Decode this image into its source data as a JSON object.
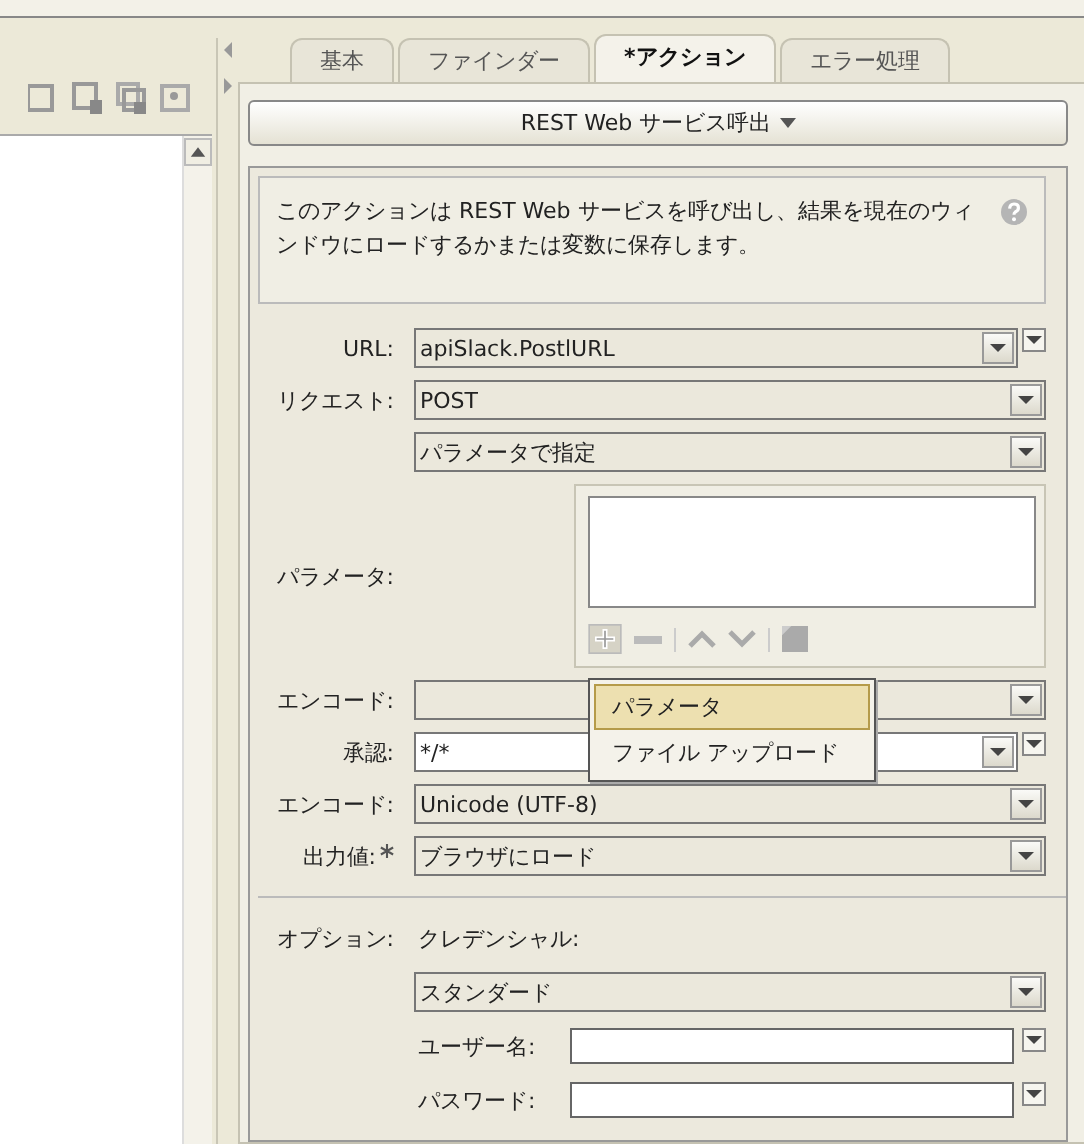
{
  "tabs": [
    {
      "label": "基本",
      "selected": false
    },
    {
      "label": "ファインダー",
      "selected": false
    },
    {
      "label": "*アクション",
      "selected": true
    },
    {
      "label": "エラー処理",
      "selected": false
    }
  ],
  "action_button": {
    "label": "REST Web サービス呼出"
  },
  "description": "このアクションは REST Web サービスを呼び出し、結果を現在のウィンドウにロードするかまたは変数に保存します。",
  "fields": [
    {
      "kind": "combo",
      "label": "URL:",
      "value": "apiSlack.PostlURL",
      "white": false
    },
    {
      "kind": "select",
      "label": "リクエスト:",
      "value": "POST"
    },
    {
      "kind": "select",
      "value": "パラメータで指定"
    },
    {
      "kind": "params",
      "label": "パラメータ:"
    },
    {
      "kind": "select",
      "label": "エンコード:"
    },
    {
      "kind": "combo",
      "label": "承認:",
      "value": "*/*",
      "white": true
    },
    {
      "kind": "select",
      "label": "エンコード:",
      "value": "Unicode (UTF-8)"
    },
    {
      "kind": "select",
      "label": "出力値:",
      "required": true,
      "value": "ブラウザにロード"
    }
  ],
  "popup_menu": [
    {
      "label": "パラメータ",
      "selected": true
    },
    {
      "label": "ファイル アップロード",
      "selected": false
    }
  ],
  "options": {
    "label": "オプション:",
    "credentials_label": "クレデンシャル:",
    "credentials_value": "スタンダード",
    "username_label": "ユーザー名:",
    "password_label": "パスワード:"
  }
}
